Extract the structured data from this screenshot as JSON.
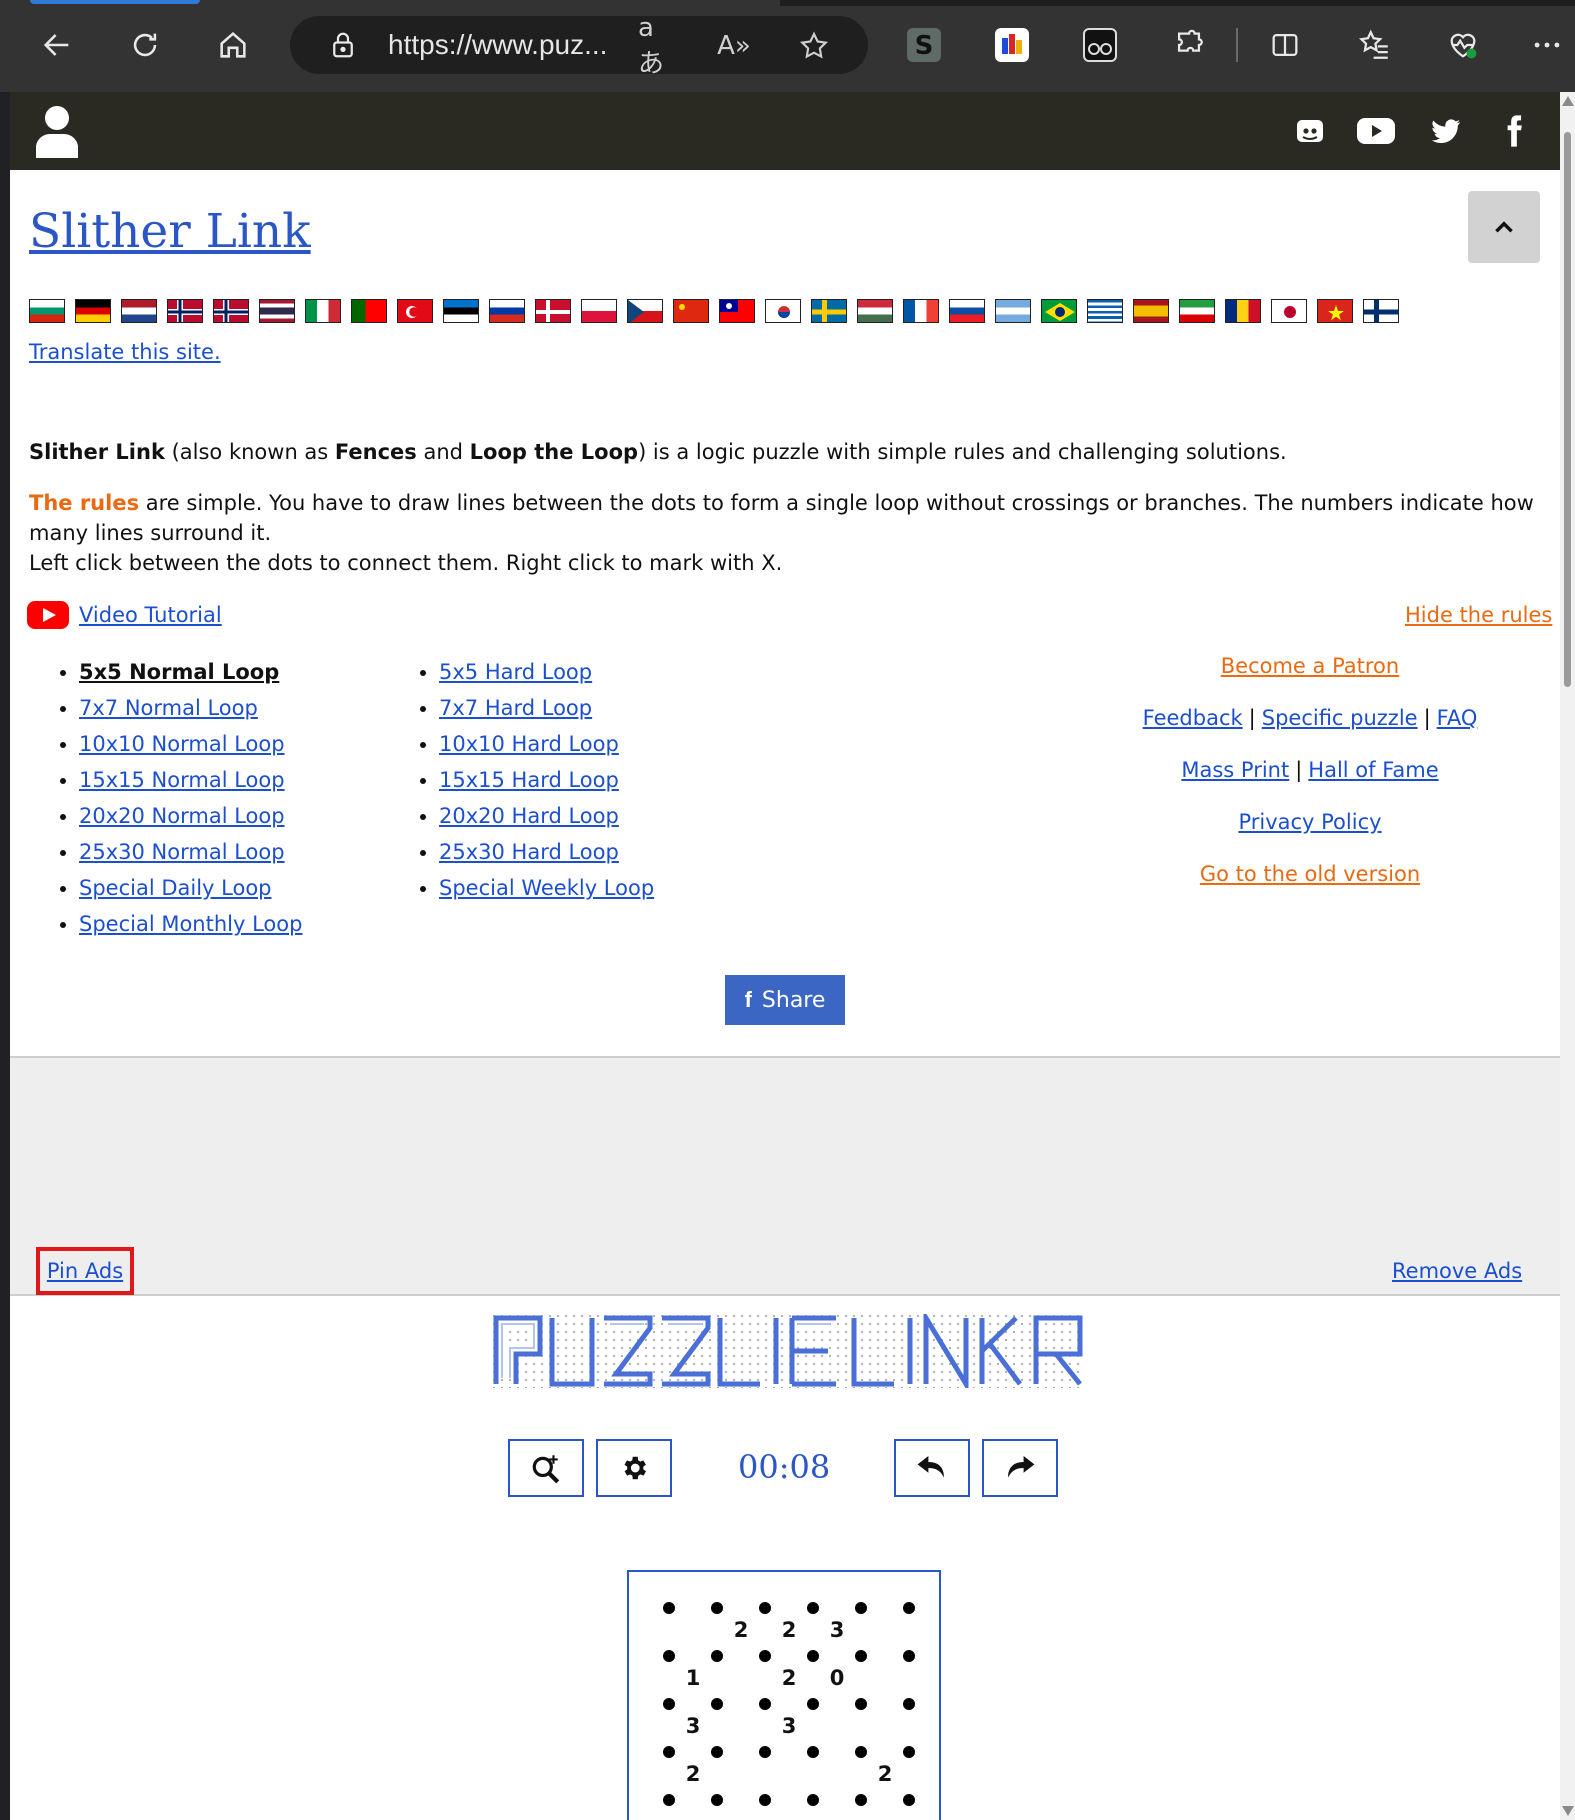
{
  "browser": {
    "url": "https://www.puz...",
    "read_aloud_glyph": "A»",
    "translate_glyph": "aあ"
  },
  "site": {
    "title": "Slither Link",
    "translate": "Translate this site.",
    "intro": {
      "name": "Slither Link",
      "aka_prefix": " (also known as ",
      "aka1": "Fences",
      "and": " and ",
      "aka2": "Loop the Loop",
      "suffix": ") is a logic puzzle with simple rules and challenging solutions."
    },
    "rules": {
      "lead": "The rules",
      "text": " are simple. You have to draw lines between the dots to form a single loop without crossings or branches. The numbers indicate how many lines surround it.",
      "line2": "Left click between the dots to connect them. Right click to mark with X."
    },
    "video_tutorial": "Video Tutorial",
    "hide_rules": "Hide the rules",
    "normal_loops": [
      "5x5 Normal Loop",
      "7x7 Normal Loop",
      "10x10 Normal Loop",
      "15x15 Normal Loop",
      "20x20 Normal Loop",
      "25x30 Normal Loop",
      "Special Daily Loop",
      "Special Monthly Loop"
    ],
    "hard_loops": [
      "5x5 Hard Loop",
      "7x7 Hard Loop",
      "10x10 Hard Loop",
      "15x15 Hard Loop",
      "20x20 Hard Loop",
      "25x30 Hard Loop",
      "Special Weekly Loop"
    ],
    "links": {
      "patron": "Become a Patron",
      "feedback": "Feedback",
      "specific": "Specific puzzle",
      "faq": "FAQ",
      "mass_print": "Mass Print",
      "hall_of_fame": "Hall of Fame",
      "privacy": "Privacy Policy",
      "old_version": "Go to the old version",
      "separator": "|"
    },
    "share": "Share",
    "pin_ads": "Pin Ads",
    "remove_ads": "Remove Ads",
    "timer": "00:08"
  },
  "puzzle": {
    "clues": [
      {
        "r": 0,
        "c": 1,
        "v": "2"
      },
      {
        "r": 0,
        "c": 2,
        "v": "2"
      },
      {
        "r": 0,
        "c": 3,
        "v": "3"
      },
      {
        "r": 1,
        "c": 0,
        "v": "1"
      },
      {
        "r": 1,
        "c": 2,
        "v": "2"
      },
      {
        "r": 1,
        "c": 3,
        "v": "0"
      },
      {
        "r": 2,
        "c": 0,
        "v": "3"
      },
      {
        "r": 2,
        "c": 2,
        "v": "3"
      },
      {
        "r": 3,
        "c": 0,
        "v": "2"
      },
      {
        "r": 3,
        "c": 4,
        "v": "2"
      }
    ]
  },
  "colors": {
    "link": "#1b4fcf",
    "accent_orange": "#ea6a12",
    "header_dark": "#2a2a22",
    "share_blue": "#3b66c4",
    "highlight_red": "#e01818"
  }
}
